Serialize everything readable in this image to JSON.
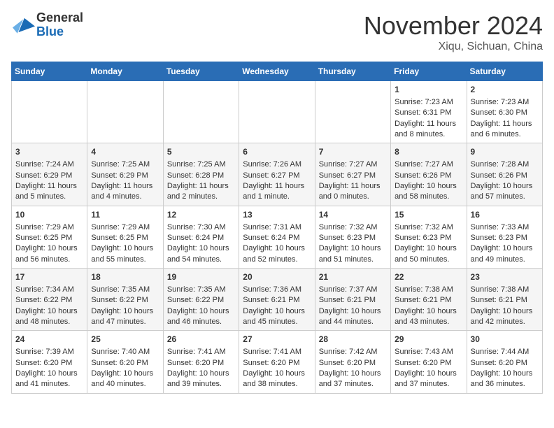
{
  "header": {
    "logo_general": "General",
    "logo_blue": "Blue",
    "month_title": "November 2024",
    "location": "Xiqu, Sichuan, China"
  },
  "weekdays": [
    "Sunday",
    "Monday",
    "Tuesday",
    "Wednesday",
    "Thursday",
    "Friday",
    "Saturday"
  ],
  "weeks": [
    [
      {
        "day": "",
        "content": ""
      },
      {
        "day": "",
        "content": ""
      },
      {
        "day": "",
        "content": ""
      },
      {
        "day": "",
        "content": ""
      },
      {
        "day": "",
        "content": ""
      },
      {
        "day": "1",
        "content": "Sunrise: 7:23 AM\nSunset: 6:31 PM\nDaylight: 11 hours and 8 minutes."
      },
      {
        "day": "2",
        "content": "Sunrise: 7:23 AM\nSunset: 6:30 PM\nDaylight: 11 hours and 6 minutes."
      }
    ],
    [
      {
        "day": "3",
        "content": "Sunrise: 7:24 AM\nSunset: 6:29 PM\nDaylight: 11 hours and 5 minutes."
      },
      {
        "day": "4",
        "content": "Sunrise: 7:25 AM\nSunset: 6:29 PM\nDaylight: 11 hours and 4 minutes."
      },
      {
        "day": "5",
        "content": "Sunrise: 7:25 AM\nSunset: 6:28 PM\nDaylight: 11 hours and 2 minutes."
      },
      {
        "day": "6",
        "content": "Sunrise: 7:26 AM\nSunset: 6:27 PM\nDaylight: 11 hours and 1 minute."
      },
      {
        "day": "7",
        "content": "Sunrise: 7:27 AM\nSunset: 6:27 PM\nDaylight: 11 hours and 0 minutes."
      },
      {
        "day": "8",
        "content": "Sunrise: 7:27 AM\nSunset: 6:26 PM\nDaylight: 10 hours and 58 minutes."
      },
      {
        "day": "9",
        "content": "Sunrise: 7:28 AM\nSunset: 6:26 PM\nDaylight: 10 hours and 57 minutes."
      }
    ],
    [
      {
        "day": "10",
        "content": "Sunrise: 7:29 AM\nSunset: 6:25 PM\nDaylight: 10 hours and 56 minutes."
      },
      {
        "day": "11",
        "content": "Sunrise: 7:29 AM\nSunset: 6:25 PM\nDaylight: 10 hours and 55 minutes."
      },
      {
        "day": "12",
        "content": "Sunrise: 7:30 AM\nSunset: 6:24 PM\nDaylight: 10 hours and 54 minutes."
      },
      {
        "day": "13",
        "content": "Sunrise: 7:31 AM\nSunset: 6:24 PM\nDaylight: 10 hours and 52 minutes."
      },
      {
        "day": "14",
        "content": "Sunrise: 7:32 AM\nSunset: 6:23 PM\nDaylight: 10 hours and 51 minutes."
      },
      {
        "day": "15",
        "content": "Sunrise: 7:32 AM\nSunset: 6:23 PM\nDaylight: 10 hours and 50 minutes."
      },
      {
        "day": "16",
        "content": "Sunrise: 7:33 AM\nSunset: 6:23 PM\nDaylight: 10 hours and 49 minutes."
      }
    ],
    [
      {
        "day": "17",
        "content": "Sunrise: 7:34 AM\nSunset: 6:22 PM\nDaylight: 10 hours and 48 minutes."
      },
      {
        "day": "18",
        "content": "Sunrise: 7:35 AM\nSunset: 6:22 PM\nDaylight: 10 hours and 47 minutes."
      },
      {
        "day": "19",
        "content": "Sunrise: 7:35 AM\nSunset: 6:22 PM\nDaylight: 10 hours and 46 minutes."
      },
      {
        "day": "20",
        "content": "Sunrise: 7:36 AM\nSunset: 6:21 PM\nDaylight: 10 hours and 45 minutes."
      },
      {
        "day": "21",
        "content": "Sunrise: 7:37 AM\nSunset: 6:21 PM\nDaylight: 10 hours and 44 minutes."
      },
      {
        "day": "22",
        "content": "Sunrise: 7:38 AM\nSunset: 6:21 PM\nDaylight: 10 hours and 43 minutes."
      },
      {
        "day": "23",
        "content": "Sunrise: 7:38 AM\nSunset: 6:21 PM\nDaylight: 10 hours and 42 minutes."
      }
    ],
    [
      {
        "day": "24",
        "content": "Sunrise: 7:39 AM\nSunset: 6:20 PM\nDaylight: 10 hours and 41 minutes."
      },
      {
        "day": "25",
        "content": "Sunrise: 7:40 AM\nSunset: 6:20 PM\nDaylight: 10 hours and 40 minutes."
      },
      {
        "day": "26",
        "content": "Sunrise: 7:41 AM\nSunset: 6:20 PM\nDaylight: 10 hours and 39 minutes."
      },
      {
        "day": "27",
        "content": "Sunrise: 7:41 AM\nSunset: 6:20 PM\nDaylight: 10 hours and 38 minutes."
      },
      {
        "day": "28",
        "content": "Sunrise: 7:42 AM\nSunset: 6:20 PM\nDaylight: 10 hours and 37 minutes."
      },
      {
        "day": "29",
        "content": "Sunrise: 7:43 AM\nSunset: 6:20 PM\nDaylight: 10 hours and 37 minutes."
      },
      {
        "day": "30",
        "content": "Sunrise: 7:44 AM\nSunset: 6:20 PM\nDaylight: 10 hours and 36 minutes."
      }
    ]
  ]
}
